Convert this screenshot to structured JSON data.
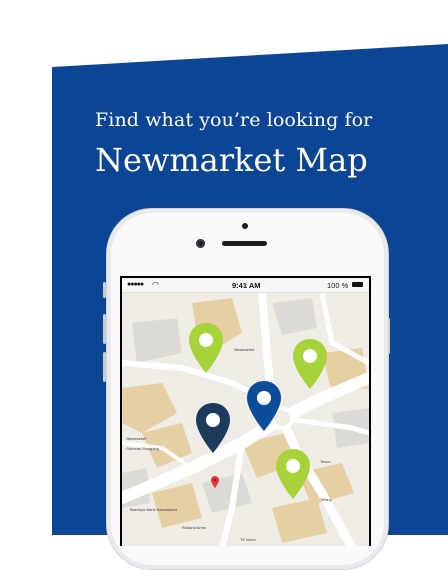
{
  "header": {
    "subtitle": "Find what you’re looking for",
    "title": "Newmarket Map"
  },
  "status_bar": {
    "signal": "●●●●●",
    "time": "9:41 AM",
    "battery": "100 %"
  },
  "map": {
    "labels": [
      "Newmarket",
      "Guineas Shopping",
      "Barclays Bank Newmarket",
      "Rutland Arms",
      "TK Maxx",
      "Tesco",
      "Tiffany",
      "Newmarket"
    ],
    "pins": [
      {
        "name": "green-pin-1",
        "color": "#a6d23a"
      },
      {
        "name": "green-pin-2",
        "color": "#a6d23a"
      },
      {
        "name": "blue-pin-1",
        "color": "#0d4c9b"
      },
      {
        "name": "navy-pin",
        "color": "#1b3a5c"
      },
      {
        "name": "green-pin-3",
        "color": "#a6d23a"
      },
      {
        "name": "red-marker",
        "color": "#e53935"
      }
    ]
  },
  "colors": {
    "panel": "#0d4595",
    "accent_green": "#a6d23a"
  }
}
